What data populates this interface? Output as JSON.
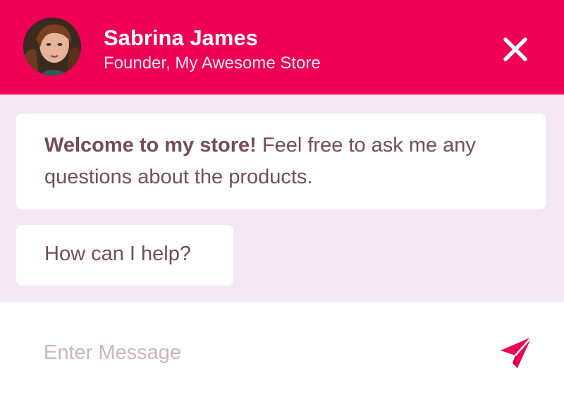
{
  "header": {
    "name": "Sabrina James",
    "subtitle": "Founder, My Awesome Store",
    "avatar_icon": "avatar-photo",
    "close_icon": "close-icon"
  },
  "messages": [
    {
      "bold": "Welcome to my store!",
      "text": " Feel free to ask me any questions about the products."
    },
    {
      "bold": "",
      "text": "How can I help?"
    }
  ],
  "composer": {
    "placeholder": "Enter Message",
    "send_icon": "send-icon"
  },
  "colors": {
    "accent": "#ee0055",
    "messages_background": "#f5e6f3",
    "message_text": "#744c5e",
    "placeholder": "#cdb4be"
  }
}
